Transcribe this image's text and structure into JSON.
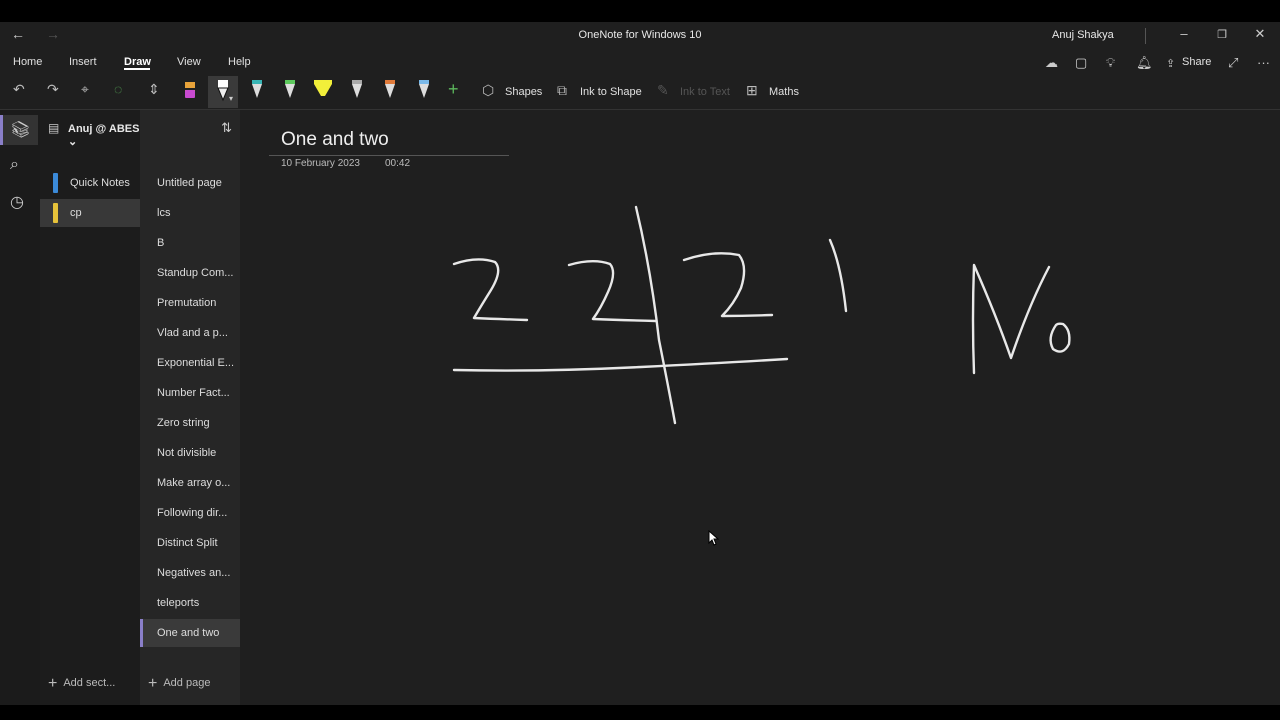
{
  "window": {
    "title": "OneNote for Windows 10",
    "user": "Anuj Shakya"
  },
  "menu": {
    "items": [
      "Home",
      "Insert",
      "Draw",
      "View",
      "Help"
    ],
    "active": "Draw",
    "share_label": "Share"
  },
  "toolbar": {
    "shapes_label": "Shapes",
    "ink_to_shape_label": "Ink to Shape",
    "ink_to_text_label": "Ink to Text",
    "maths_label": "Maths"
  },
  "notebook": {
    "name": "Anuj @ ABES",
    "sections": [
      {
        "label": "Quick Notes",
        "color": "#3b8ad9"
      },
      {
        "label": "cp",
        "color": "#e6c23a"
      }
    ],
    "add_section_label": "Add sect...",
    "add_page_label": "Add page"
  },
  "pages": [
    "Untitled page",
    "lcs",
    "B",
    "Standup Com...",
    "Premutation",
    "Vlad and a p...",
    "Exponential E...",
    "Number Fact...",
    "Zero string",
    "Not divisible",
    "Make array o...",
    "Following dir...",
    "Distinct Split",
    "Negatives an...",
    "teleports",
    "One and two"
  ],
  "active_page": "One and two",
  "note": {
    "title": "One and two",
    "date": "10 February 2023",
    "time": "00:42"
  },
  "accent_color": "#8a7fc9"
}
